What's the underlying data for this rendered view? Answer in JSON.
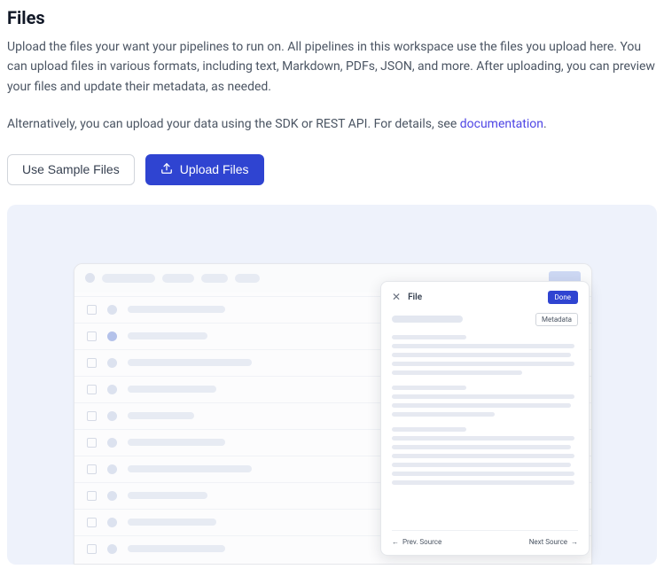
{
  "page": {
    "title": "Files",
    "description": "Upload the files your want your pipelines to run on. All pipelines in this workspace use the files you upload here. You can upload files in various formats, including text, Markdown, PDFs, JSON, and more. After uploading, you can preview your files and update their metadata, as needed.",
    "alt_prefix": "Alternatively, you can upload your data using the SDK or REST API. For details, see ",
    "alt_link": "documentation",
    "alt_suffix": "."
  },
  "buttons": {
    "sample": "Use Sample Files",
    "upload": "Upload Files"
  },
  "panel": {
    "title": "File",
    "done": "Done",
    "metadata": "Metadata",
    "prev": "Prev. Source",
    "next": "Next Source"
  }
}
